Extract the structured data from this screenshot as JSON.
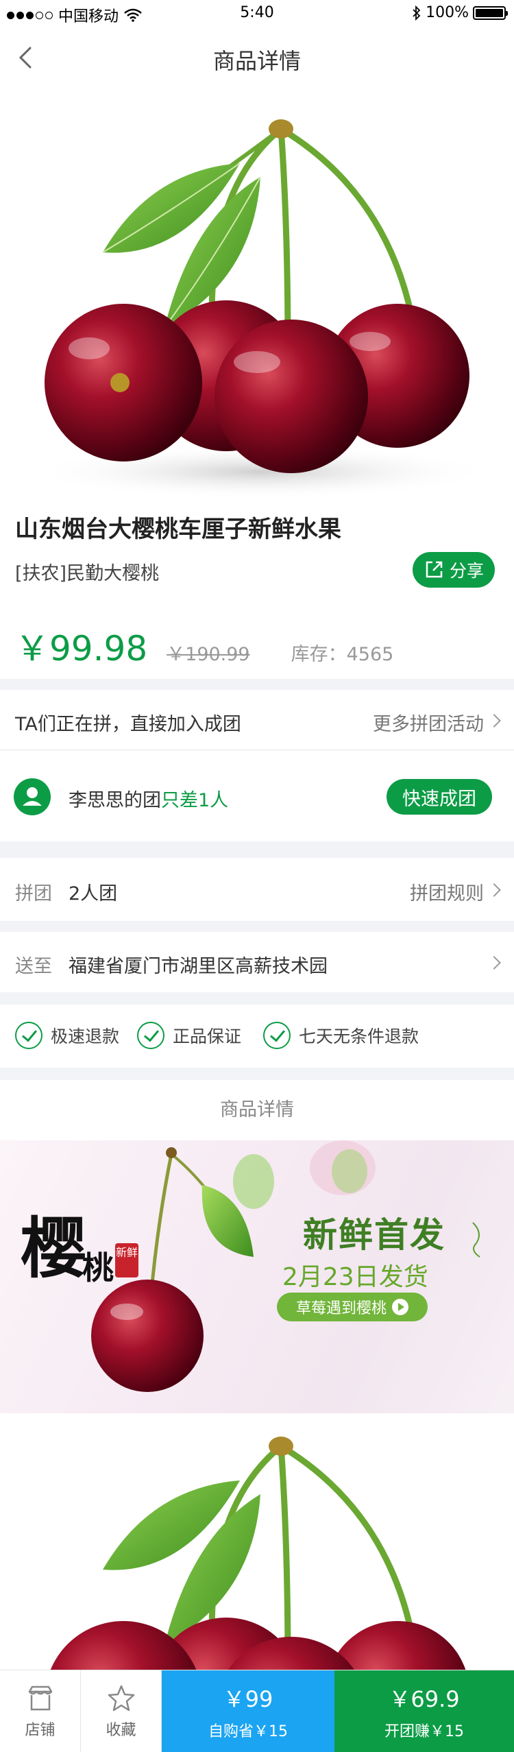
{
  "status_bar": {
    "carrier": "中国移动",
    "time": "5:40",
    "battery": "100%"
  },
  "nav": {
    "title": "商品详情",
    "back_icon": "chevron-left-icon"
  },
  "product": {
    "name": "山东烟台大樱桃车厘子新鲜水果",
    "subtitle": "[扶农]民勤大樱桃",
    "share_label": "分享",
    "price": "￥99.98",
    "original_price": "￥190.99",
    "stock": "库存：4565"
  },
  "group": {
    "intro": "TA们正在拼，直接加入成团",
    "more_label": "更多拼团活动",
    "leader_name": "李思思的团",
    "leader_need": "只差1人",
    "join_label": "快速成团"
  },
  "spec": {
    "label": "拼团",
    "value": "2人团",
    "rules_label": "拼团规则"
  },
  "address": {
    "label": "送至",
    "value": "福建省厦门市湖里区高薪技术园"
  },
  "assurances": [
    "极速退款",
    "正品保证",
    "七天无条件退款"
  ],
  "detail_title": "商品详情",
  "banner": {
    "brand_big": "樱",
    "brand_small": "桃",
    "tag": "新鲜",
    "title": "新鲜首发",
    "date": "2月23日发货",
    "pill": "草莓遇到樱桃"
  },
  "bottom_bar": {
    "shop_label": "店铺",
    "favorite_label": "收藏",
    "self_price": "￥99",
    "self_label": "自购省￥15",
    "group_price": "￥69.9",
    "group_label": "开团赚￥15"
  },
  "colors": {
    "accent_green": "#0c9c46",
    "accent_blue": "#1ba4f2"
  }
}
